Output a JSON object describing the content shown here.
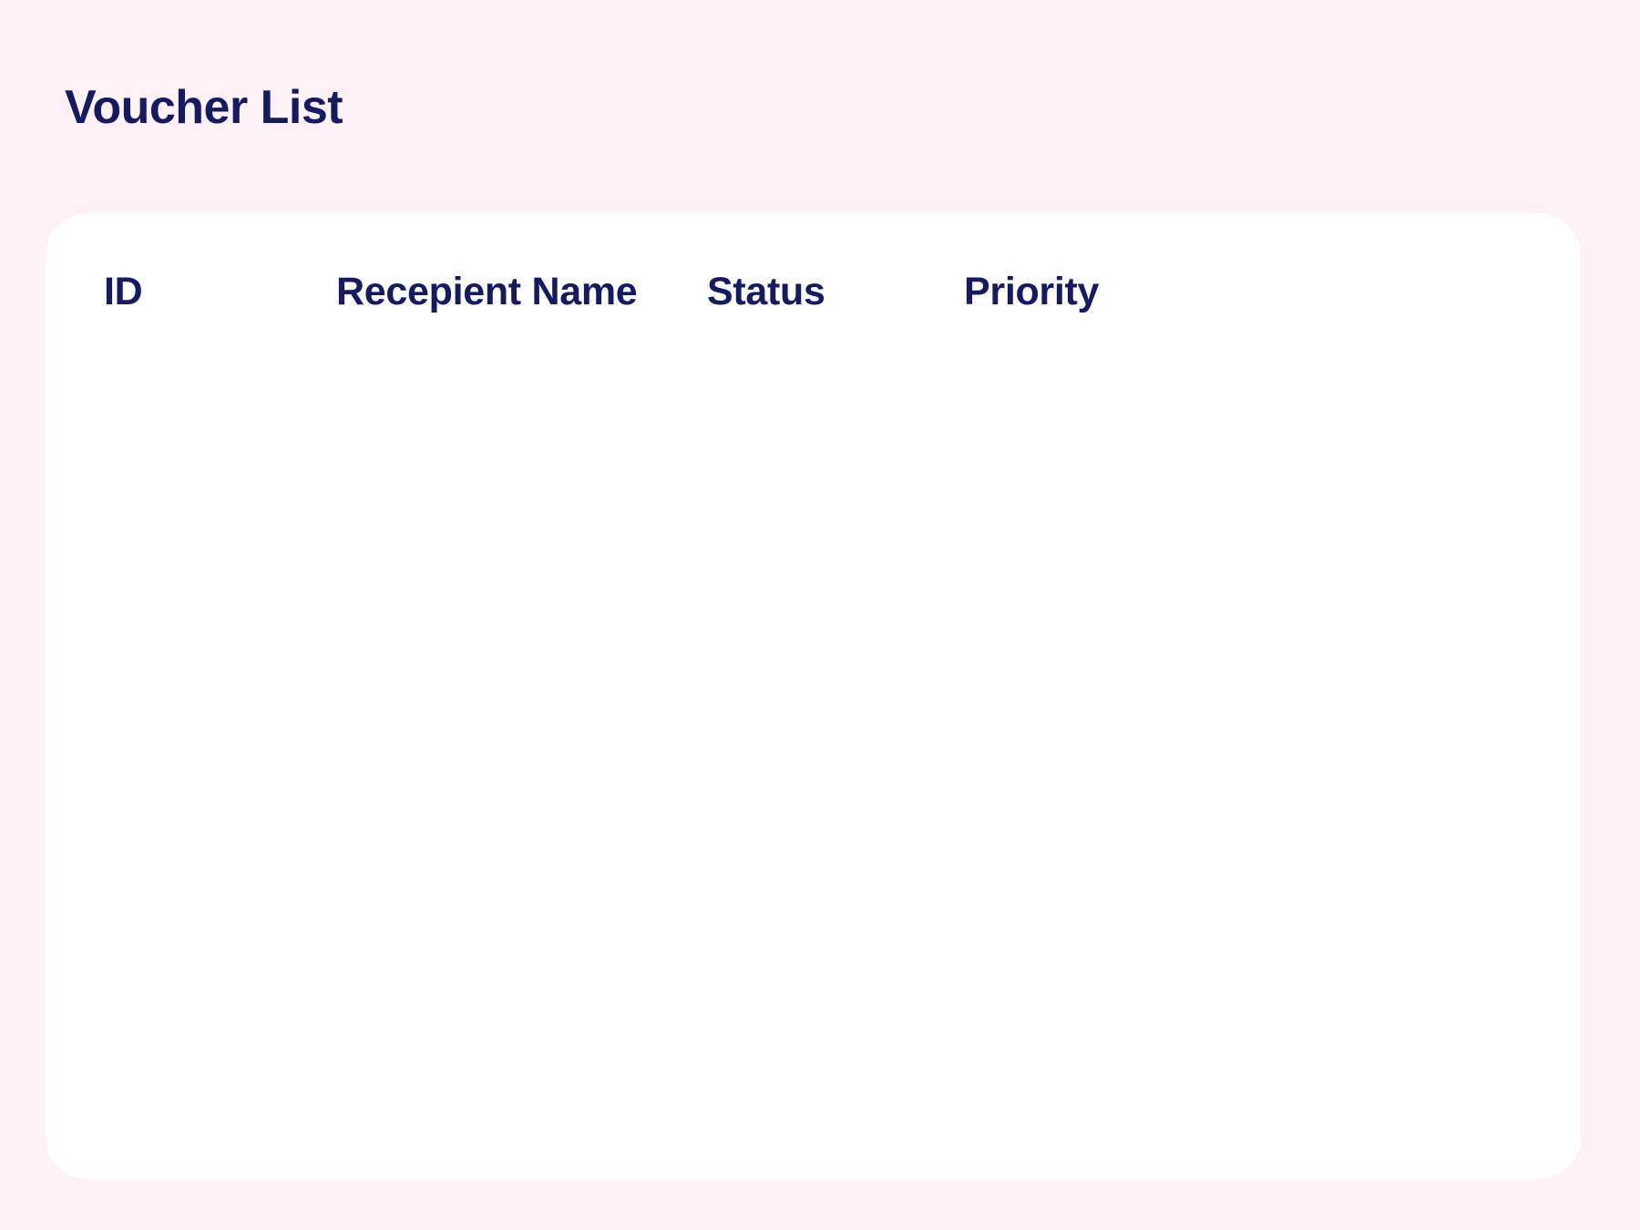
{
  "page": {
    "title": "Voucher List",
    "background_color": "#fff2f6",
    "text_color": "#141b63",
    "card_color": "#ffffff"
  },
  "table": {
    "columns": [
      {
        "label": "ID"
      },
      {
        "label": "Recepient Name"
      },
      {
        "label": "Status"
      },
      {
        "label": "Priority"
      }
    ],
    "rows": []
  }
}
